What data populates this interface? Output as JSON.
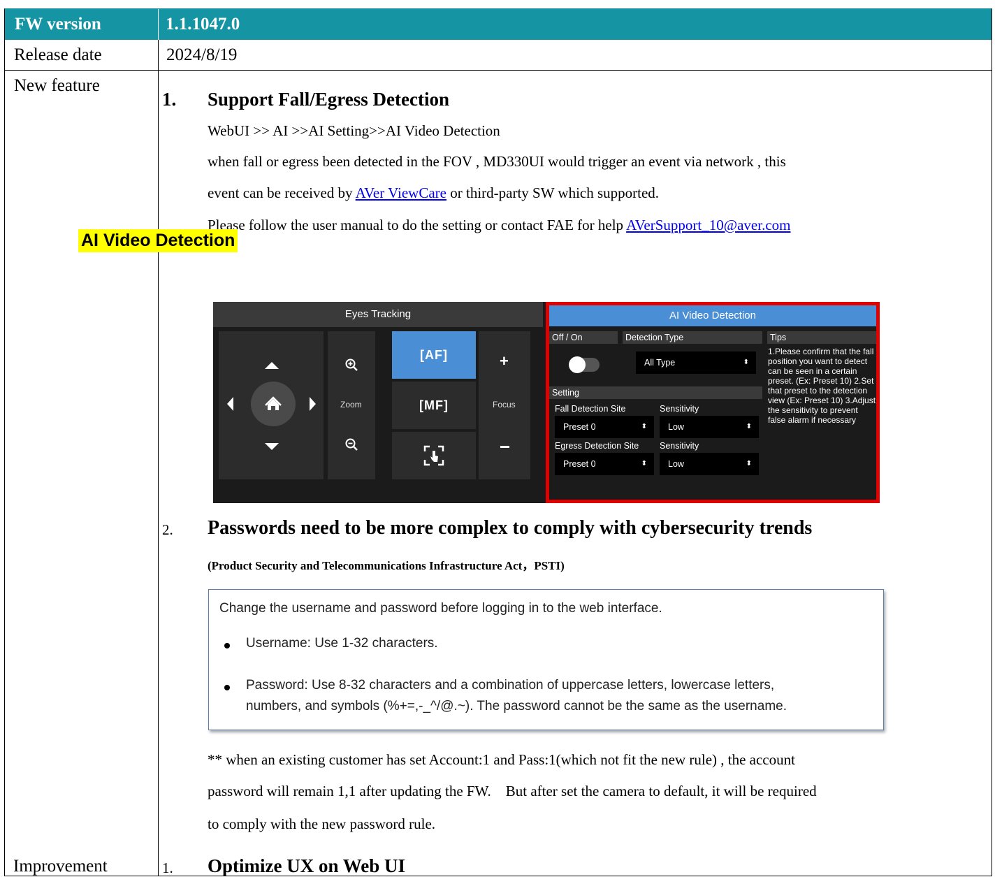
{
  "header": {
    "label": "FW version",
    "value": "1.1.1047.0"
  },
  "release": {
    "label": "Release date",
    "value": "2024/8/19"
  },
  "new_feature": {
    "label": "New feature",
    "item1": {
      "num": "1.",
      "title": "Support Fall/Egress Detection",
      "path": "WebUI >> AI >>AI Setting>>AI Video Detection",
      "line1": "when fall or egress been detected in the FOV , MD330UI would trigger an event via network , this",
      "line2_a": "event can be received by ",
      "line2_link": "AVer ViewCare",
      "line2_b": " or third-party SW which supported.",
      "line3_a": "Please follow the user manual to do the setting or contact FAE for help ",
      "line3_link": "AVerSupport_10@aver.com",
      "highlight": "AI Video Detection"
    },
    "camera_ui": {
      "eyes_tracking": "Eyes Tracking",
      "zoom": "Zoom",
      "focus": "Focus",
      "af": "[AF]",
      "mf": "[MF]",
      "ai_title": "AI Video Detection",
      "off_on": "Off / On",
      "detection_type": "Detection Type",
      "detection_type_value": "All Type",
      "tips": "Tips",
      "setting": "Setting",
      "fall_site": "Fall Detection Site",
      "sensitivity": "Sensitivity",
      "egress_site": "Egress Detection Site",
      "preset_value": "Preset 0",
      "low_value": "Low",
      "tips_text": "1.Please confirm that the fall position you want to detect can be seen in a certain preset. (Ex: Preset 10) 2.Set that preset to the detection view (Ex: Preset 10) 3.Adjust the sensitivity to prevent false alarm if necessary"
    },
    "item2": {
      "num": "2.",
      "title": "Passwords need to be more complex to comply with cybersecurity trends",
      "subtitle": "(Product Security and Telecommunications Infrastructure Act，PSTI)",
      "box_intro": "Change the username and password before logging in to the web interface.",
      "bullet1": "Username: Use 1-32 characters.",
      "bullet2_l1": "Password: Use 8-32 characters and a combination of uppercase letters, lowercase letters,",
      "bullet2_l2": "numbers, and symbols (%+=,-_^/@.~). The password cannot be the same as the username.",
      "note_l1": "** when an existing customer has set Account:1 and Pass:1(which not fit the new rule) , the account",
      "note_l2": "password will remain 1,1 after updating the FW.    But after set the camera to default, it will be required",
      "note_l3": "to comply with the new password rule."
    }
  },
  "improvement": {
    "label": "Improvement",
    "num": "1.",
    "title": "Optimize UX on Web UI"
  },
  "colors": {
    "header_bg": "#1594a4",
    "highlight": "#ffff00",
    "link": "#0000ee",
    "ai_border": "#e10000",
    "active_blue": "#4a8fd6"
  }
}
